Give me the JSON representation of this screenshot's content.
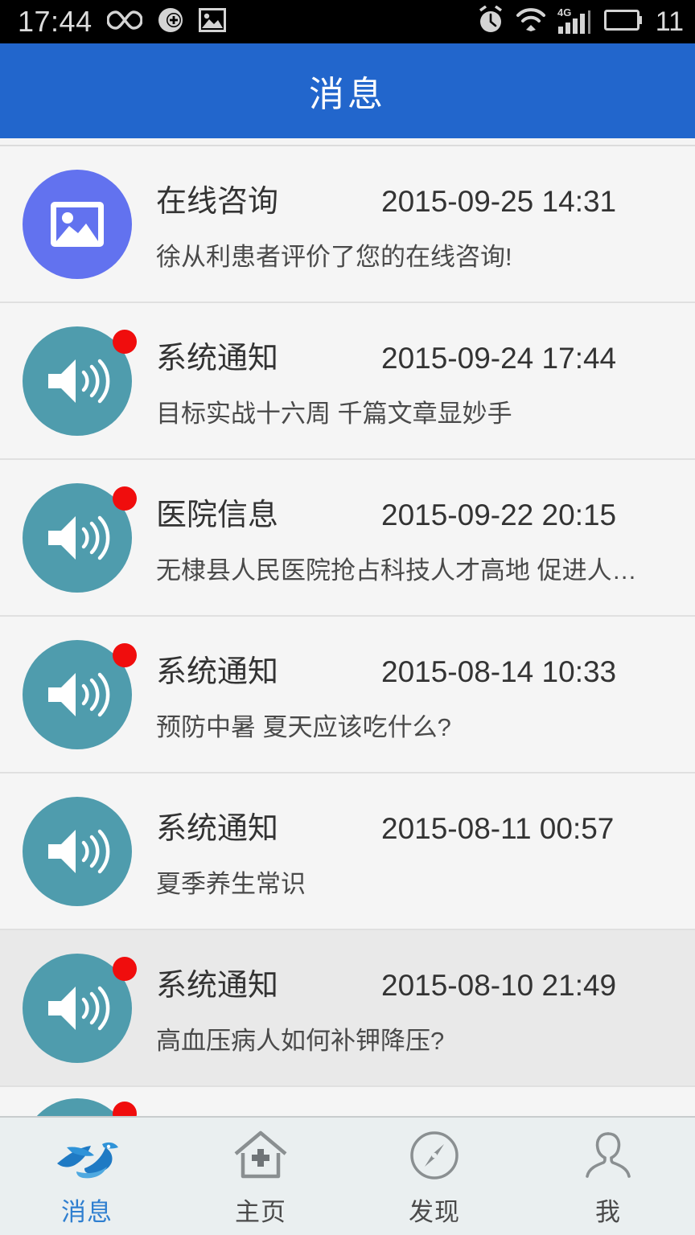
{
  "statusbar": {
    "time": "17:44",
    "battery_percent": "11",
    "left_icons": [
      "infinity-icon",
      "sync-plus-icon",
      "image-icon"
    ],
    "right_icons": [
      "alarm-clock-icon",
      "wifi-icon",
      "signal-4g-icon",
      "battery-icon"
    ]
  },
  "header": {
    "title": "消息",
    "bg_color": "#2266cc"
  },
  "messages": [
    {
      "avatar": "photo-placeholder-icon",
      "avatar_color": "#6272ef",
      "unread": false,
      "title": "在线咨询",
      "date": "2015-09-25 14:31",
      "subtitle": "徐从利患者评价了您的在线咨询!",
      "pressed": false
    },
    {
      "avatar": "speaker-icon",
      "avatar_color": "#4f9cad",
      "unread": true,
      "title": "系统通知",
      "date": "2015-09-24 17:44",
      "subtitle": "目标实战十六周 千篇文章显妙手",
      "pressed": false
    },
    {
      "avatar": "speaker-icon",
      "avatar_color": "#4f9cad",
      "unread": true,
      "title": "医院信息",
      "date": "2015-09-22 20:15",
      "subtitle": "无棣县人民医院抢占科技人才高地 促进人才…",
      "pressed": false
    },
    {
      "avatar": "speaker-icon",
      "avatar_color": "#4f9cad",
      "unread": true,
      "title": "系统通知",
      "date": "2015-08-14 10:33",
      "subtitle": "预防中暑 夏天应该吃什么?",
      "pressed": false
    },
    {
      "avatar": "speaker-icon",
      "avatar_color": "#4f9cad",
      "unread": false,
      "title": "系统通知",
      "date": "2015-08-11 00:57",
      "subtitle": "夏季养生常识",
      "pressed": false
    },
    {
      "avatar": "speaker-icon",
      "avatar_color": "#4f9cad",
      "unread": true,
      "title": "系统通知",
      "date": "2015-08-10 21:49",
      "subtitle": "高血压病人如何补钾降压?",
      "pressed": true
    }
  ],
  "tabbar": {
    "active_color": "#2f7fd0",
    "items": [
      {
        "label": "消息",
        "icon": "dove-icon",
        "active": true
      },
      {
        "label": "主页",
        "icon": "home-cross-icon",
        "active": false
      },
      {
        "label": "发现",
        "icon": "compass-icon",
        "active": false
      },
      {
        "label": "我",
        "icon": "person-icon",
        "active": false
      }
    ]
  }
}
